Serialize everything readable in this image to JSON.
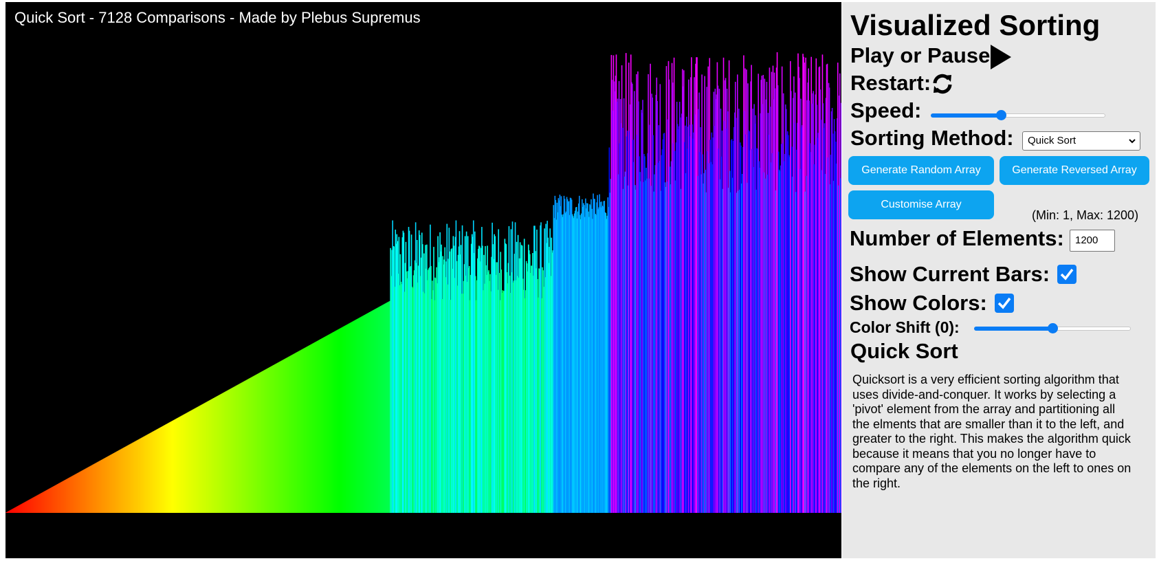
{
  "visualizer": {
    "title": "Quick Sort - 7128 Comparisons - Made by Plebus Supremus",
    "element_count": 1200,
    "sorted_fraction": 0.46,
    "partition_fractions": [
      0.655,
      0.722
    ],
    "colors": [
      "#ff0000",
      "#ffff00",
      "#00ff00",
      "#00ffff",
      "#0000ff",
      "#ff00ff"
    ]
  },
  "panel": {
    "heading": "Visualized Sorting",
    "play_label": "Play or Pause:",
    "restart_label": "Restart:",
    "speed_label": "Speed:",
    "speed_value": 0.4,
    "method_label": "Sorting Method:",
    "method_selected": "Quick Sort",
    "btn_random": "Generate Random Array",
    "btn_reversed": "Generate Reversed Array",
    "btn_customise": "Customise Array",
    "range_hint": "(Min: 1, Max: 1200)",
    "elements_label": "Number of Elements:",
    "elements_value": "1200",
    "show_bars_label": "Show Current Bars:",
    "show_bars_checked": true,
    "show_colors_label": "Show Colors:",
    "show_colors_checked": true,
    "color_shift_label": "Color Shift (0):",
    "color_shift_value": 0.5,
    "algo_title": "Quick Sort",
    "algo_description": "Quicksort is a very efficient sorting algorithm that uses divide-and-conquer. It works by selecting a 'pivot' element from the array and partitioning all the elments that are smaller than it to the left, and greater to the right. This makes the algorithm quick because it means that you no longer have to compare any of the elements on the left to ones on the right.",
    "accent_color": "#0da4f0",
    "control_color": "#0a7cf5"
  }
}
